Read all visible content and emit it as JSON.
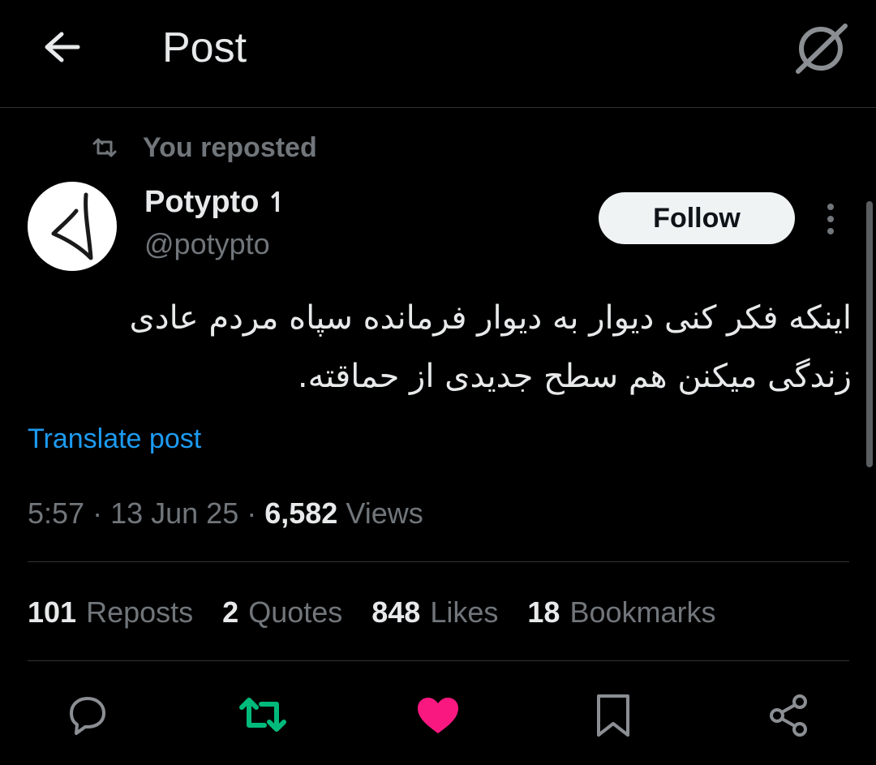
{
  "header": {
    "title": "Post",
    "back_icon": "arrow-left-icon",
    "right_icon": "grok-icon"
  },
  "repost_context": {
    "label": "You reposted",
    "icon": "repost-icon"
  },
  "author": {
    "name": "Potypto",
    "name_suffix": "↿",
    "handle": "@potypto",
    "follow_label": "Follow"
  },
  "post": {
    "text": "اینکه فکر کنی دیوار به دیوار فرمانده سپاه مردم عادی زندگی میکنن هم سطح جدیدی از حماقته.",
    "translate_label": "Translate post"
  },
  "meta": {
    "time": "5:57",
    "sep1": " · ",
    "date": "13 Jun 25",
    "sep2": " · ",
    "views": "6,582",
    "views_label": "Views"
  },
  "stats": [
    {
      "num": "101",
      "label": "Reposts"
    },
    {
      "num": "2",
      "label": "Quotes"
    },
    {
      "num": "848",
      "label": "Likes"
    },
    {
      "num": "18",
      "label": "Bookmarks"
    }
  ],
  "colors": {
    "background": "#000000",
    "text_primary": "#e7e9ea",
    "text_secondary": "#71767b",
    "link": "#1d9bf0",
    "repost_active": "#00ba7c",
    "like_active": "#f91880"
  }
}
